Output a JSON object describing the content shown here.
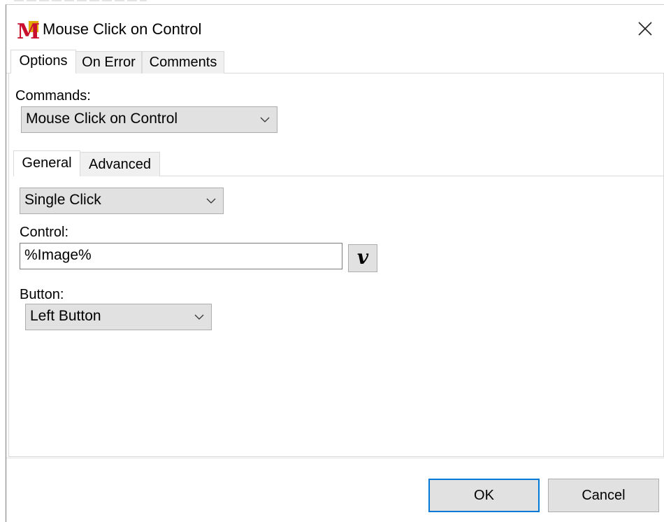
{
  "window": {
    "title": "Mouse Click on Control",
    "logo_letter": "M"
  },
  "outer_tabs": [
    {
      "label": "Options",
      "active": true
    },
    {
      "label": "On Error",
      "active": false
    },
    {
      "label": "Comments",
      "active": false
    }
  ],
  "commands": {
    "label": "Commands:",
    "selected": "Mouse Click on Control"
  },
  "inner_tabs": [
    {
      "label": "General",
      "active": true
    },
    {
      "label": "Advanced",
      "active": false
    }
  ],
  "general": {
    "click_type": "Single Click",
    "control_label": "Control:",
    "control_value": "%Image%",
    "variable_button": "v",
    "button_label": "Button:",
    "button_value": "Left Button"
  },
  "footer": {
    "ok_label": "OK",
    "cancel_label": "Cancel"
  },
  "colors": {
    "accent": "#0078d7",
    "logo_red": "#c8102e",
    "logo_gold": "#e0a800"
  },
  "icons": {
    "close": "close-icon",
    "dropdown": "chevron-down-icon",
    "logo": "app-logo-icon"
  }
}
